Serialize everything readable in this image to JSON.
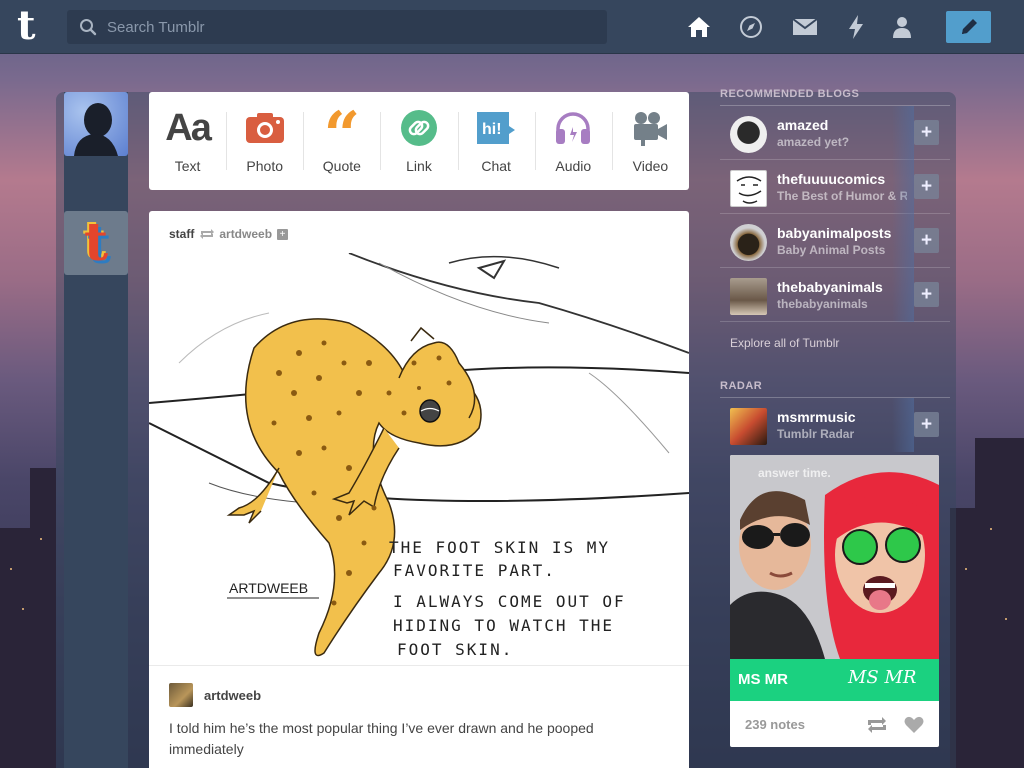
{
  "topbar": {
    "search_placeholder": "Search Tumblr",
    "nav_icons": [
      "home-icon",
      "compass-icon",
      "mail-icon",
      "lightning-icon",
      "person-icon"
    ],
    "compose_icon": "pencil-icon"
  },
  "post_types": [
    {
      "label": "Text",
      "icon": "text-icon",
      "color": "#444444"
    },
    {
      "label": "Photo",
      "icon": "camera-icon",
      "color": "#d95e40"
    },
    {
      "label": "Quote",
      "icon": "quote-icon",
      "color": "#f2992e"
    },
    {
      "label": "Link",
      "icon": "link-icon",
      "color": "#56bc8a"
    },
    {
      "label": "Chat",
      "icon": "chat-icon",
      "color": "#529ecc"
    },
    {
      "label": "Audio",
      "icon": "headphones-icon",
      "color": "#a77dc2"
    },
    {
      "label": "Video",
      "icon": "video-camera-icon",
      "color": "#748089"
    }
  ],
  "post": {
    "author": "staff",
    "reblogged_from": "artdweeb",
    "artwork": {
      "signature": "ARTDWEEB",
      "lines": [
        "THE FOOT SKIN IS MY",
        "FAVORITE PART.",
        "I ALWAYS COME OUT OF",
        "HIDING TO WATCH THE",
        "FOOT SKIN."
      ]
    },
    "reblog_user": "artdweeb",
    "caption": "I told him he’s the most popular thing I’ve ever drawn and he pooped immediately"
  },
  "sidebar": {
    "recommended_title": "RECOMMENDED BLOGS",
    "blogs": [
      {
        "name": "amazed",
        "title": "amazed yet?"
      },
      {
        "name": "thefuuuucomics",
        "title": "The Best of Humor & Rage"
      },
      {
        "name": "babyanimalposts",
        "title": "Baby Animal Posts"
      },
      {
        "name": "thebabyanimals",
        "title": "thebabyanimals"
      }
    ],
    "explore_link": "Explore all of Tumblr",
    "radar_title": "RADAR",
    "radar": {
      "name": "msmrmusic",
      "title": "Tumblr Radar",
      "overlay": "answer time.",
      "band": "MS MR",
      "band_signature": "MS MR",
      "notes": "239 notes"
    }
  }
}
